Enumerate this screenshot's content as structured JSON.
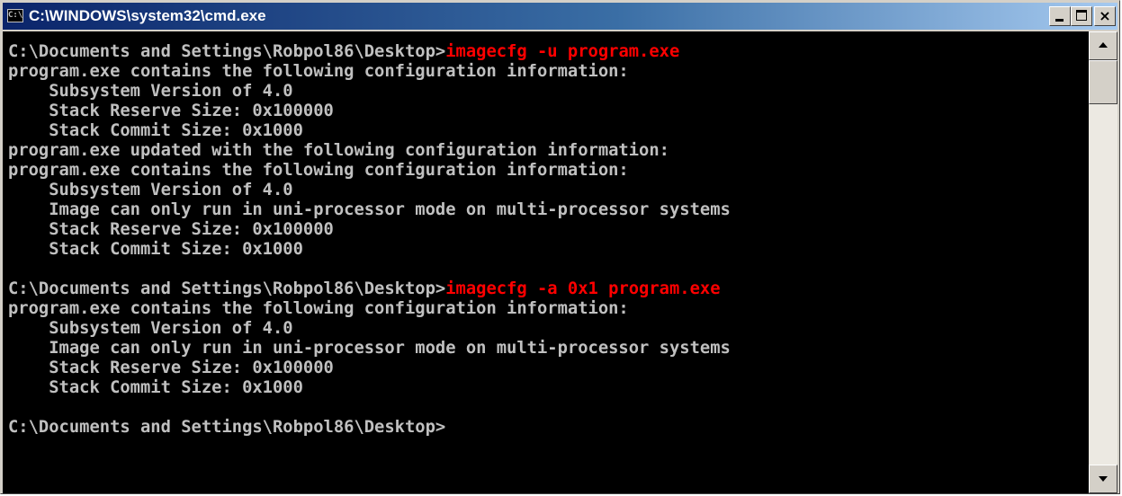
{
  "window": {
    "title": "C:\\WINDOWS\\system32\\cmd.exe",
    "icon": "console-icon",
    "icon_glyph": "C:\\"
  },
  "colors": {
    "console_background": "#000000",
    "console_text": "#c0c0c0",
    "command_text": "#ff0000"
  },
  "console": {
    "lines": [
      {
        "prompt": "C:\\Documents and Settings\\Robpol86\\Desktop>",
        "command": "imagecfg -u program.exe"
      },
      {
        "text": "program.exe contains the following configuration information:"
      },
      {
        "text": "    Subsystem Version of 4.0"
      },
      {
        "text": "    Stack Reserve Size: 0x100000"
      },
      {
        "text": "    Stack Commit Size: 0x1000"
      },
      {
        "text": "program.exe updated with the following configuration information:"
      },
      {
        "text": "program.exe contains the following configuration information:"
      },
      {
        "text": "    Subsystem Version of 4.0"
      },
      {
        "text": "    Image can only run in uni-processor mode on multi-processor systems"
      },
      {
        "text": "    Stack Reserve Size: 0x100000"
      },
      {
        "text": "    Stack Commit Size: 0x1000"
      },
      {
        "text": ""
      },
      {
        "prompt": "C:\\Documents and Settings\\Robpol86\\Desktop>",
        "command": "imagecfg -a 0x1 program.exe"
      },
      {
        "text": "program.exe contains the following configuration information:"
      },
      {
        "text": "    Subsystem Version of 4.0"
      },
      {
        "text": "    Image can only run in uni-processor mode on multi-processor systems"
      },
      {
        "text": "    Stack Reserve Size: 0x100000"
      },
      {
        "text": "    Stack Commit Size: 0x1000"
      },
      {
        "text": ""
      },
      {
        "prompt": "C:\\Documents and Settings\\Robpol86\\Desktop>",
        "command": ""
      }
    ]
  }
}
